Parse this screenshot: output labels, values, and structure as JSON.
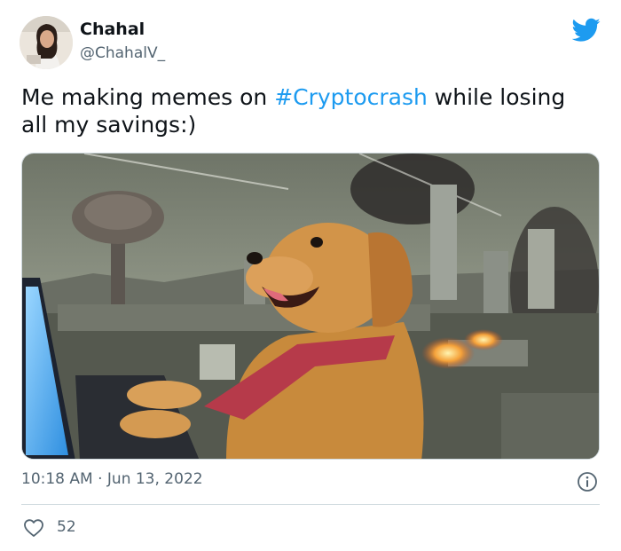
{
  "author": {
    "name": "Chahal",
    "handle": "@ChahalV_"
  },
  "tweet": {
    "text_before": "Me making memes on ",
    "hashtag": "#Cryptocrash",
    "text_after": " while losing all my savings:)"
  },
  "meta": {
    "timestamp": "10:18 AM · Jun 13, 2022",
    "like_count": "52"
  },
  "colors": {
    "link": "#1d9bf0",
    "secondary_text": "#536471",
    "twitter_blue": "#1d9bf0"
  },
  "icons": [
    "twitter-bird-icon",
    "info-icon",
    "heart-icon"
  ]
}
